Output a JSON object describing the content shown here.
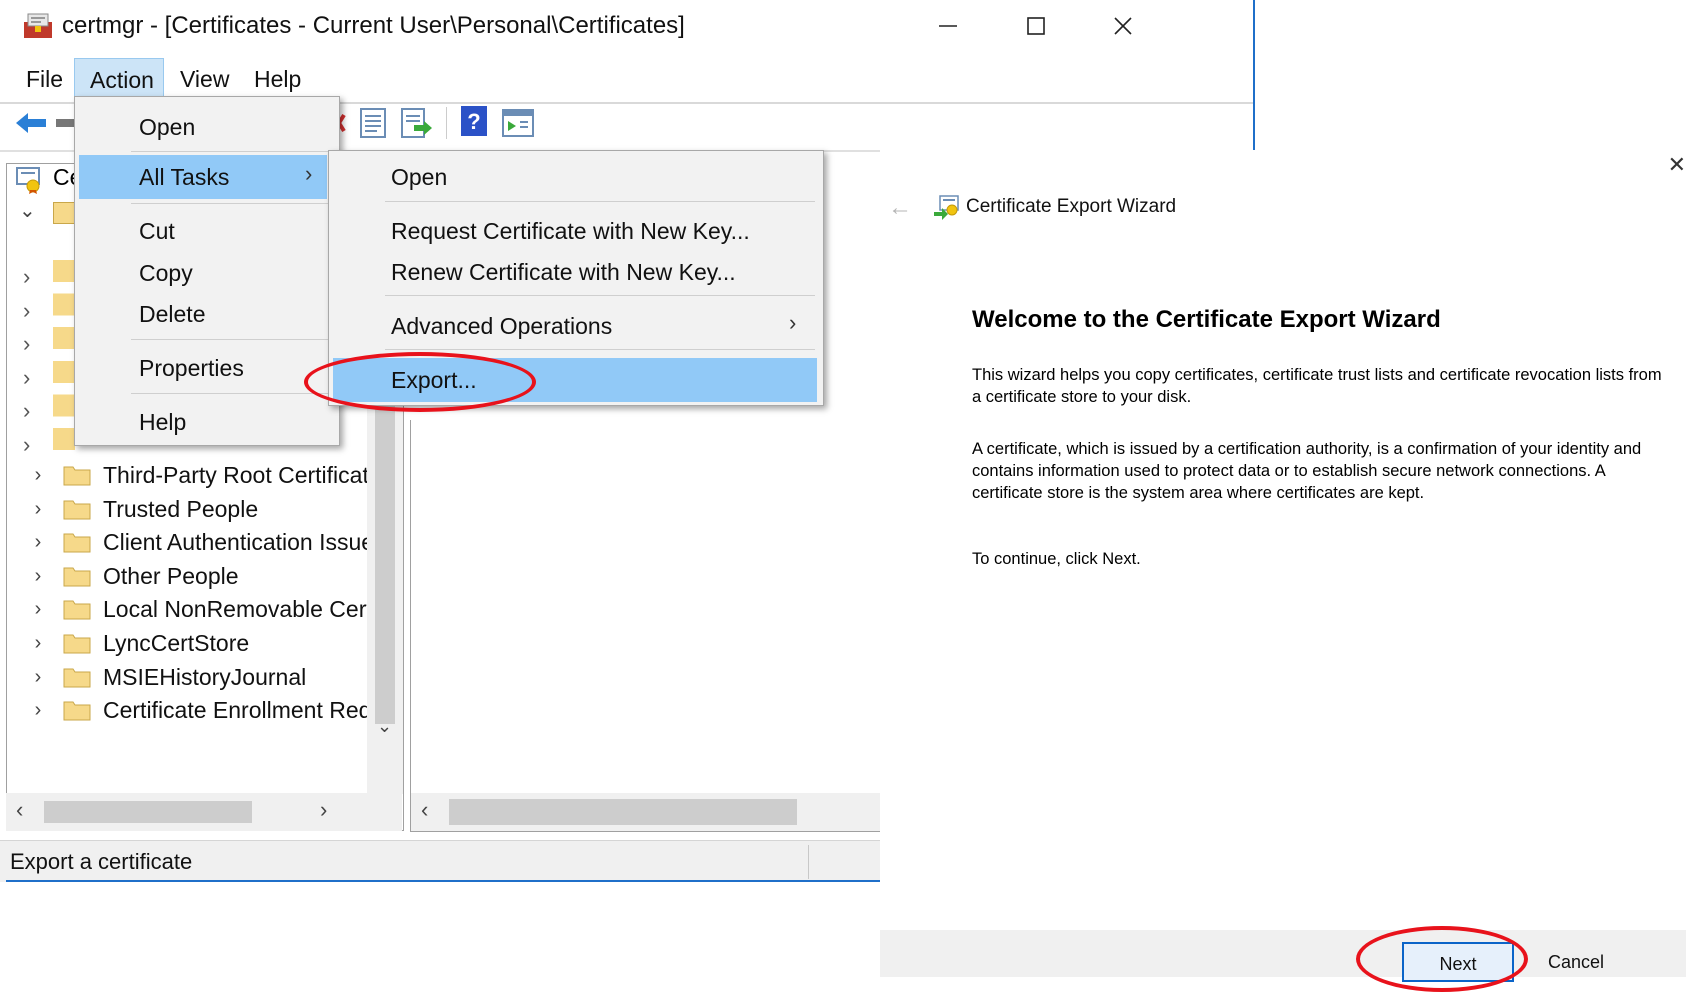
{
  "window": {
    "title": "certmgr - [Certificates - Current User\\Personal\\Certificates]",
    "menus": [
      "File",
      "Action",
      "View",
      "Help"
    ],
    "active_menu": "Action",
    "root_label_partial": "Ce"
  },
  "action_menu": {
    "items": [
      "Open",
      "All Tasks",
      "Cut",
      "Copy",
      "Delete",
      "Properties",
      "Help"
    ],
    "highlighted": "All Tasks"
  },
  "all_tasks_menu": {
    "items": [
      "Open",
      "Request Certificate with New Key...",
      "Renew Certificate with New Key...",
      "Advanced Operations",
      "Export..."
    ],
    "highlighted": "Export..."
  },
  "tree": {
    "items": [
      "Third-Party Root Certificat",
      "Trusted People",
      "Client Authentication Issue",
      "Other People",
      "Local NonRemovable Certi",
      "LyncCertStore",
      "MSIEHistoryJournal",
      "Certificate Enrollment Req"
    ]
  },
  "status": {
    "text": "Export a certificate"
  },
  "wizard": {
    "title": "Certificate Export Wizard",
    "heading": "Welcome to the Certificate Export Wizard",
    "para1": "This wizard helps you copy certificates, certificate trust lists and certificate revocation lists from a certificate store to your disk.",
    "para2": "A certificate, which is issued by a certification authority, is a confirmation of your identity and contains information used to protect data or to establish secure network connections. A certificate store is the system area where certificates are kept.",
    "para3": "To continue, click Next.",
    "next_label": "Next",
    "cancel_label": "Cancel"
  },
  "colors": {
    "highlight": "#91c9f7",
    "menu_active": "#cce4f7",
    "annotation": "#e8121b",
    "accent": "#0a64c8"
  }
}
